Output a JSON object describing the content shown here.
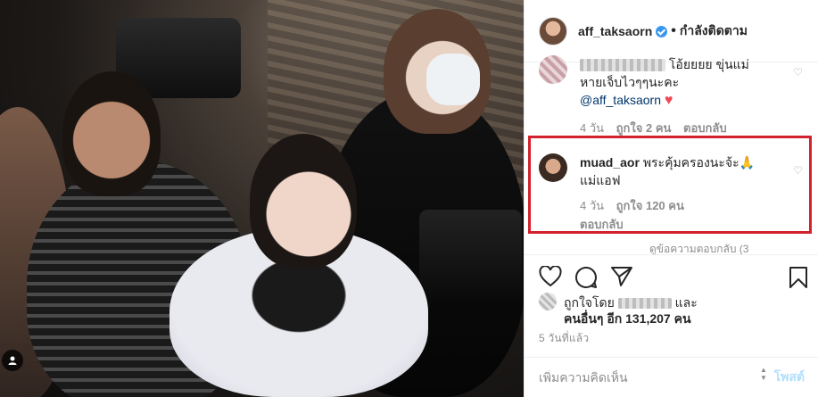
{
  "header": {
    "username": "aff_taksaorn",
    "follow_label": "กำลังติดตาม"
  },
  "comments": [
    {
      "text_line1": "โอ้ยยยย ขุ่นแม่",
      "text_line2": "หายเจ็บไวๆๆนะคะ",
      "mention": "@aff_taksaorn",
      "time": "4 วัน",
      "likes": "ถูกใจ 2 คน",
      "reply": "ตอบกลับ"
    },
    {
      "username": "muad_aor",
      "text_line1": "พระคุ้มครองนะจ้ะ🙏",
      "text_line2": "แม่แอฟ",
      "time": "4 วัน",
      "likes": "ถูกใจ 120 คน",
      "reply": "ตอบกลับ"
    }
  ],
  "more_replies": "ดูข้อความตอบกลับ (3",
  "liked_by": {
    "prefix": "ถูกใจโดย",
    "suffix": "และ",
    "others": "คนอื่นๆ อีก 131,207 คน"
  },
  "posted_time": "5 วันที่แล้ว",
  "add_comment": {
    "placeholder": "เพิ่มความคิดเห็น",
    "post_label": "โพสต์"
  },
  "colors": {
    "verified": "#3897f0",
    "highlight": "#d2222d",
    "heart": "#ed4956",
    "post_button": "#b2dffc"
  }
}
